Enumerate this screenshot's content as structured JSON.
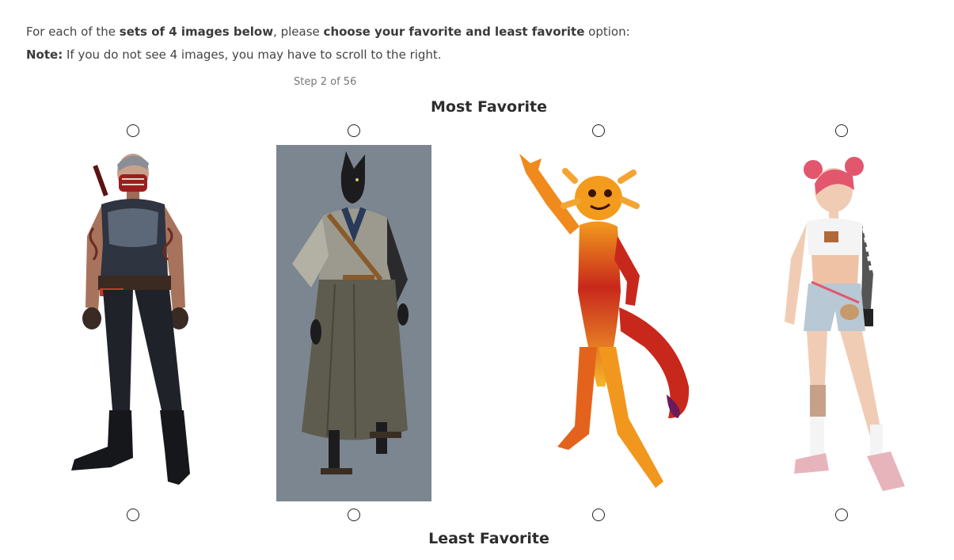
{
  "instructions": {
    "line1_prefix": "For each of the ",
    "line1_bold1": "sets of 4 images below",
    "line1_mid": ", please ",
    "line1_bold2": "choose your favorite and least favorite",
    "line1_suffix": " option:",
    "note_label": "Note:",
    "note_text": " If you do not see 4 images, you may have to scroll to the right."
  },
  "step_text": "Step 2 of 56",
  "most_favorite_label": "Most Favorite",
  "least_favorite_label": "Least Favorite",
  "options": [
    {
      "icon": "masked-soldier-figure",
      "selected_most": false,
      "selected_least": false
    },
    {
      "icon": "cat-samurai-figure",
      "selected_most": false,
      "selected_least": false
    },
    {
      "icon": "fire-axolotl-figure",
      "selected_most": false,
      "selected_least": false
    },
    {
      "icon": "pink-hair-girl-figure",
      "selected_most": false,
      "selected_least": false
    }
  ],
  "colors": {
    "panel_gray": "#7c8690",
    "fire_red": "#c8281b",
    "fire_orange": "#f39b1d",
    "hair_pink": "#e2566e"
  }
}
